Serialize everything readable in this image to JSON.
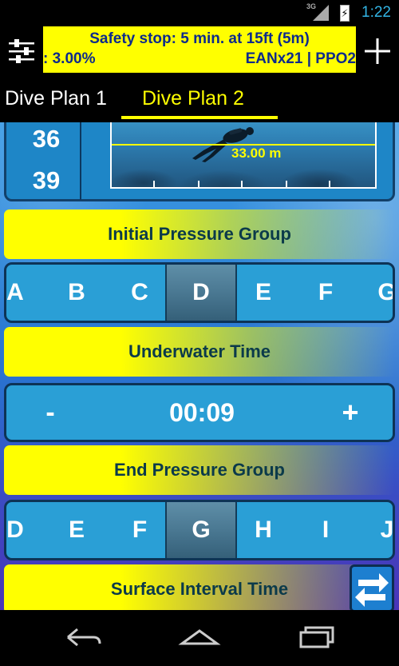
{
  "status_bar": {
    "network": "3G",
    "time": "1:22"
  },
  "banner": {
    "line1": "Safety stop: 5 min. at 15ft (5m)",
    "line2_left": ": 3.00%",
    "line2_right": "EANx21 | PPO2"
  },
  "tabs": [
    {
      "label": "Dive Plan 1",
      "selected": false
    },
    {
      "label": "Dive Plan 2",
      "selected": true
    }
  ],
  "depth_panel": {
    "depths": [
      "36",
      "39"
    ],
    "current_depth": "33.00 m"
  },
  "initial_pressure_group": {
    "label": "Initial Pressure Group",
    "letters": [
      "A",
      "B",
      "C",
      "D",
      "E",
      "F",
      "G"
    ],
    "selected": "D"
  },
  "underwater_time": {
    "label": "Underwater Time",
    "minus": "-",
    "value": "00:09",
    "plus": "+"
  },
  "end_pressure_group": {
    "label": "End Pressure Group",
    "letters": [
      "D",
      "E",
      "F",
      "G",
      "H",
      "I",
      "J"
    ],
    "selected": "G"
  },
  "surface_interval": {
    "label": "Surface Interval Time"
  },
  "colors": {
    "accent_yellow": "#ffff00",
    "banner_text": "#0d2a8c",
    "selector_blue": "#2a9fd6",
    "status_blue": "#33b5e5"
  },
  "icons": {
    "settings": "sliders-icon",
    "add": "plus-icon",
    "swap": "swap-arrows-icon",
    "back": "back-icon",
    "home": "home-icon",
    "recents": "recent-apps-icon"
  }
}
